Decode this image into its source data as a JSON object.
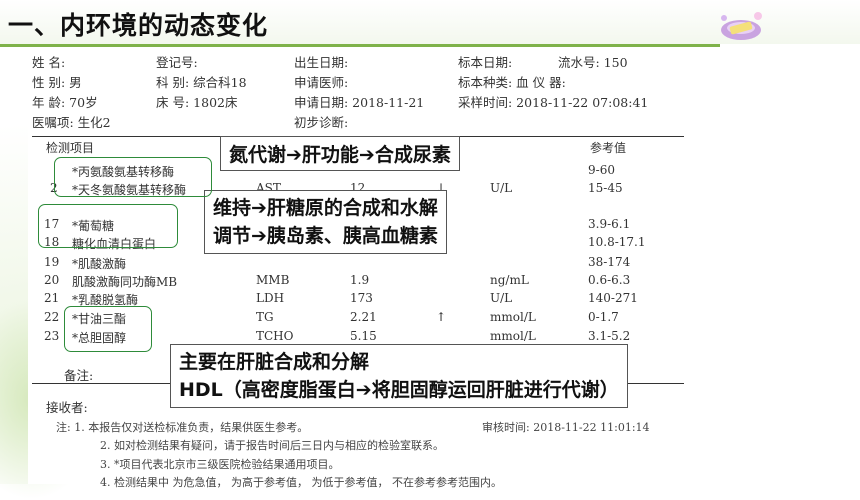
{
  "slide": {
    "title": "一、内环境的动态变化"
  },
  "colors": {
    "accent_green": "#7fb24a",
    "box_green": "#2e8b3a"
  },
  "report": {
    "header_rows": [
      [
        "姓  名:",
        "登记号:",
        "出生日期:",
        "标本日期:",
        "流水号: 150"
      ],
      [
        "性  别: 男",
        "科  别: 综合科18",
        "申请医师:",
        "标本种类: 血  仪  器:",
        ""
      ],
      [
        "年  龄: 70岁",
        "床  号: 1802床",
        "申请日期: 2018-11-21",
        "采样时间: 2018-11-22 07:08:41",
        ""
      ],
      [
        "医嘱项: 生化2",
        "",
        "初步诊断:",
        "",
        ""
      ]
    ],
    "col_item": "检测项目",
    "col_ref": "参考值",
    "rows": [
      {
        "no": "",
        "name": "*丙氨酸氨基转移酶",
        "abbr": "",
        "value": "",
        "flag": "",
        "unit": "",
        "ref": "9-60"
      },
      {
        "no": "2",
        "name": "*天冬氨酸氨基转移酶",
        "abbr": "AST",
        "value": "12",
        "flag": "↓",
        "unit": "U/L",
        "ref": "15-45"
      },
      {
        "no": "17",
        "name": "*葡萄糖",
        "abbr": "",
        "value": "",
        "flag": "",
        "unit": "",
        "ref": "3.9-6.1"
      },
      {
        "no": "18",
        "name": "糖化血清白蛋白",
        "abbr": "",
        "value": "",
        "flag": "",
        "unit": "",
        "ref": "10.8-17.1"
      },
      {
        "no": "19",
        "name": "*肌酸激酶",
        "abbr": "",
        "value": "",
        "flag": "",
        "unit": "",
        "ref": "38-174"
      },
      {
        "no": "20",
        "name": "肌酸激酶同功酶MB",
        "abbr": "MMB",
        "value": "1.9",
        "flag": "",
        "unit": "ng/mL",
        "ref": "0.6-6.3"
      },
      {
        "no": "21",
        "name": "*乳酸脱氢酶",
        "abbr": "LDH",
        "value": "173",
        "flag": "",
        "unit": "U/L",
        "ref": "140-271"
      },
      {
        "no": "22",
        "name": "*甘油三酯",
        "abbr": "TG",
        "value": "2.21",
        "flag": "↑",
        "unit": "mmol/L",
        "ref": "0-1.7"
      },
      {
        "no": "23",
        "name": "*总胆固醇",
        "abbr": "TCHO",
        "value": "5.15",
        "flag": "",
        "unit": "mmol/L",
        "ref": "3.1-5.2"
      }
    ],
    "remark_label": "备注:",
    "receiver_label": "接收者:",
    "review_time": "审核时间: 2018-11-22 11:01:14",
    "notes": [
      "注: 1.  本报告仅对送检标准负责，结果供医生参考。",
      "2.  如对检测结果有疑问，请于报告时间后三日内与相应的检验室联系。",
      "3.  *项目代表北京市三级医院检验结果通用项目。",
      "4.  检测结果中     为危急值，    为高于参考值，    为低于参考值，    不在参考参考范围内。"
    ]
  },
  "callouts": {
    "nitrogen": "氮代谢➔肝功能➔合成尿素",
    "glucose_line1": "维持➔肝糖原的合成和水解",
    "glucose_line2": "调节➔胰岛素、胰高血糖素",
    "lipid_line1": "主要在肝脏合成和分解",
    "lipid_line2": "HDL（高密度脂蛋白➔将胆固醇运回肝脏进行代谢）"
  }
}
